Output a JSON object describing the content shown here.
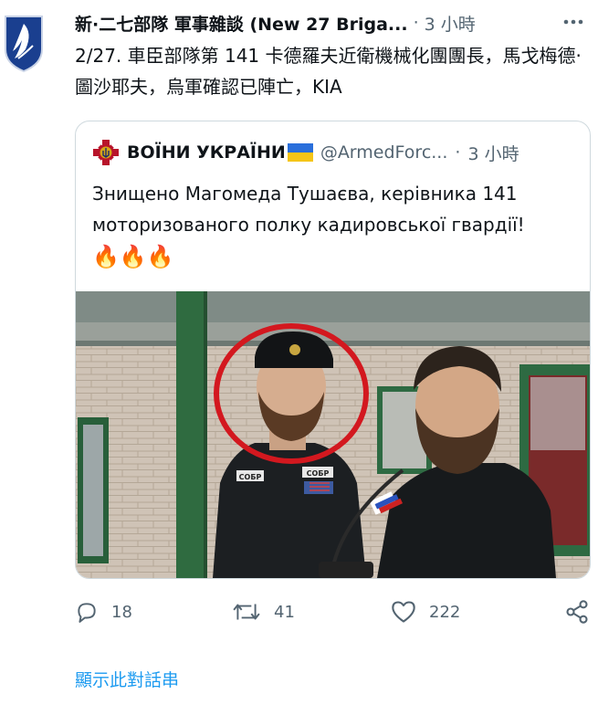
{
  "tweet": {
    "author": "新·二七部隊 軍事雜談 (New 27 Briga...",
    "separator": "·",
    "time": "3 小時",
    "text": "2/27. 車臣部隊第 141 卡德羅夫近衛機械化團團長，馬戈梅德·圖沙耶夫，烏軍確認已陣亡，KIA"
  },
  "quote": {
    "name": "ВОЇНИ УКРАЇНИ",
    "handle": "@ArmedForc...",
    "separator": "·",
    "time": "3 小時",
    "text": "Знищено Магомеда Тушаєва, керівника 141 моторизованого полку кадировської гвардії!",
    "emoji": "🔥🔥🔥",
    "photo_patches": [
      "СОБР",
      "СОБР"
    ]
  },
  "actions": {
    "reply_count": "18",
    "retweet_count": "41",
    "like_count": "222"
  },
  "show_thread": "顯示此對話串",
  "colors": {
    "link": "#1d9bf0",
    "secondary": "#536471",
    "border": "#cfd9de",
    "avatar_bg": "#1a3f8f"
  },
  "icons": [
    "brigade-logo-icon",
    "more-icon",
    "army-emblem-icon",
    "ukraine-flag-icon",
    "reply-icon",
    "retweet-icon",
    "like-icon",
    "share-icon"
  ]
}
